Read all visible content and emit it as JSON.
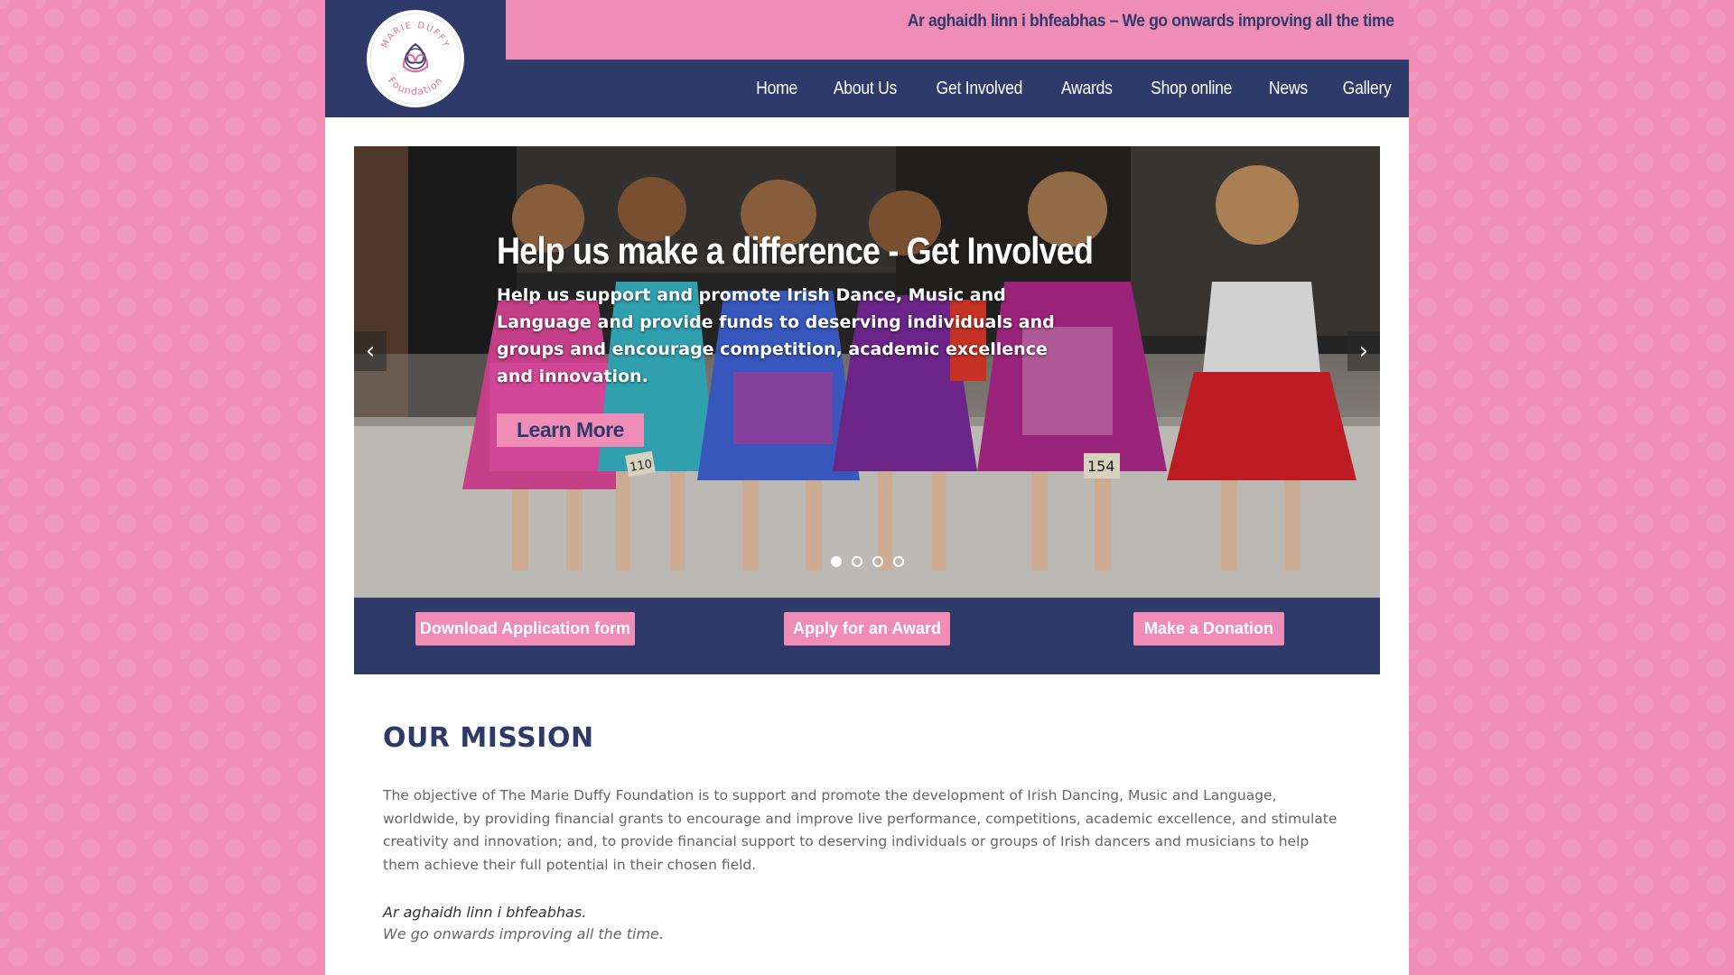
{
  "header": {
    "logo": {
      "top_text": "MARIE DUFFY",
      "bottom_text": "Foundation"
    },
    "tagline": "Ar aghaidh linn i bhfeabhas – We go onwards improving all the time"
  },
  "nav": {
    "items": [
      {
        "label": "Home"
      },
      {
        "label": "About Us"
      },
      {
        "label": "Get Involved"
      },
      {
        "label": "Awards"
      },
      {
        "label": "Shop online"
      },
      {
        "label": "News"
      },
      {
        "label": "Gallery"
      }
    ]
  },
  "slider": {
    "title": "Help us make a difference - Get Involved",
    "text": "Help us support and promote Irish Dance, Music and Language and provide funds to deserving individuals and groups and encourage competition, academic excellence and innovation.",
    "button_label": "Learn More",
    "prev_icon": "chevron-left-icon",
    "next_icon": "chevron-right-icon",
    "prev_glyph": "‹",
    "next_glyph": "›",
    "slide_count": 4,
    "active_slide": 1,
    "dancer_numbers": [
      "110",
      "154"
    ]
  },
  "actions": {
    "download_label": "Download Application form",
    "apply_label": "Apply for an Award",
    "donate_label": "Make a Donation"
  },
  "mission": {
    "title": "OUR MISSION",
    "text": "The objective of The Marie Duffy Foundation is to support and promote the development of Irish Dancing, Music and Language, worldwide, by providing financial grants to encourage and improve live performance, competitions, academic excellence, and stimulate creativity and innovation; and, to provide financial support to deserving individuals or groups of Irish dancers and musicians to help them achieve their full potential in their chosen field.",
    "motto_irish": "Ar aghaidh linn i bhfeabhas.",
    "motto_english": "We go onwards improving all the time."
  },
  "colors": {
    "background_pink": "#f08db7",
    "navy": "#2e3a6a",
    "white": "#ffffff"
  }
}
